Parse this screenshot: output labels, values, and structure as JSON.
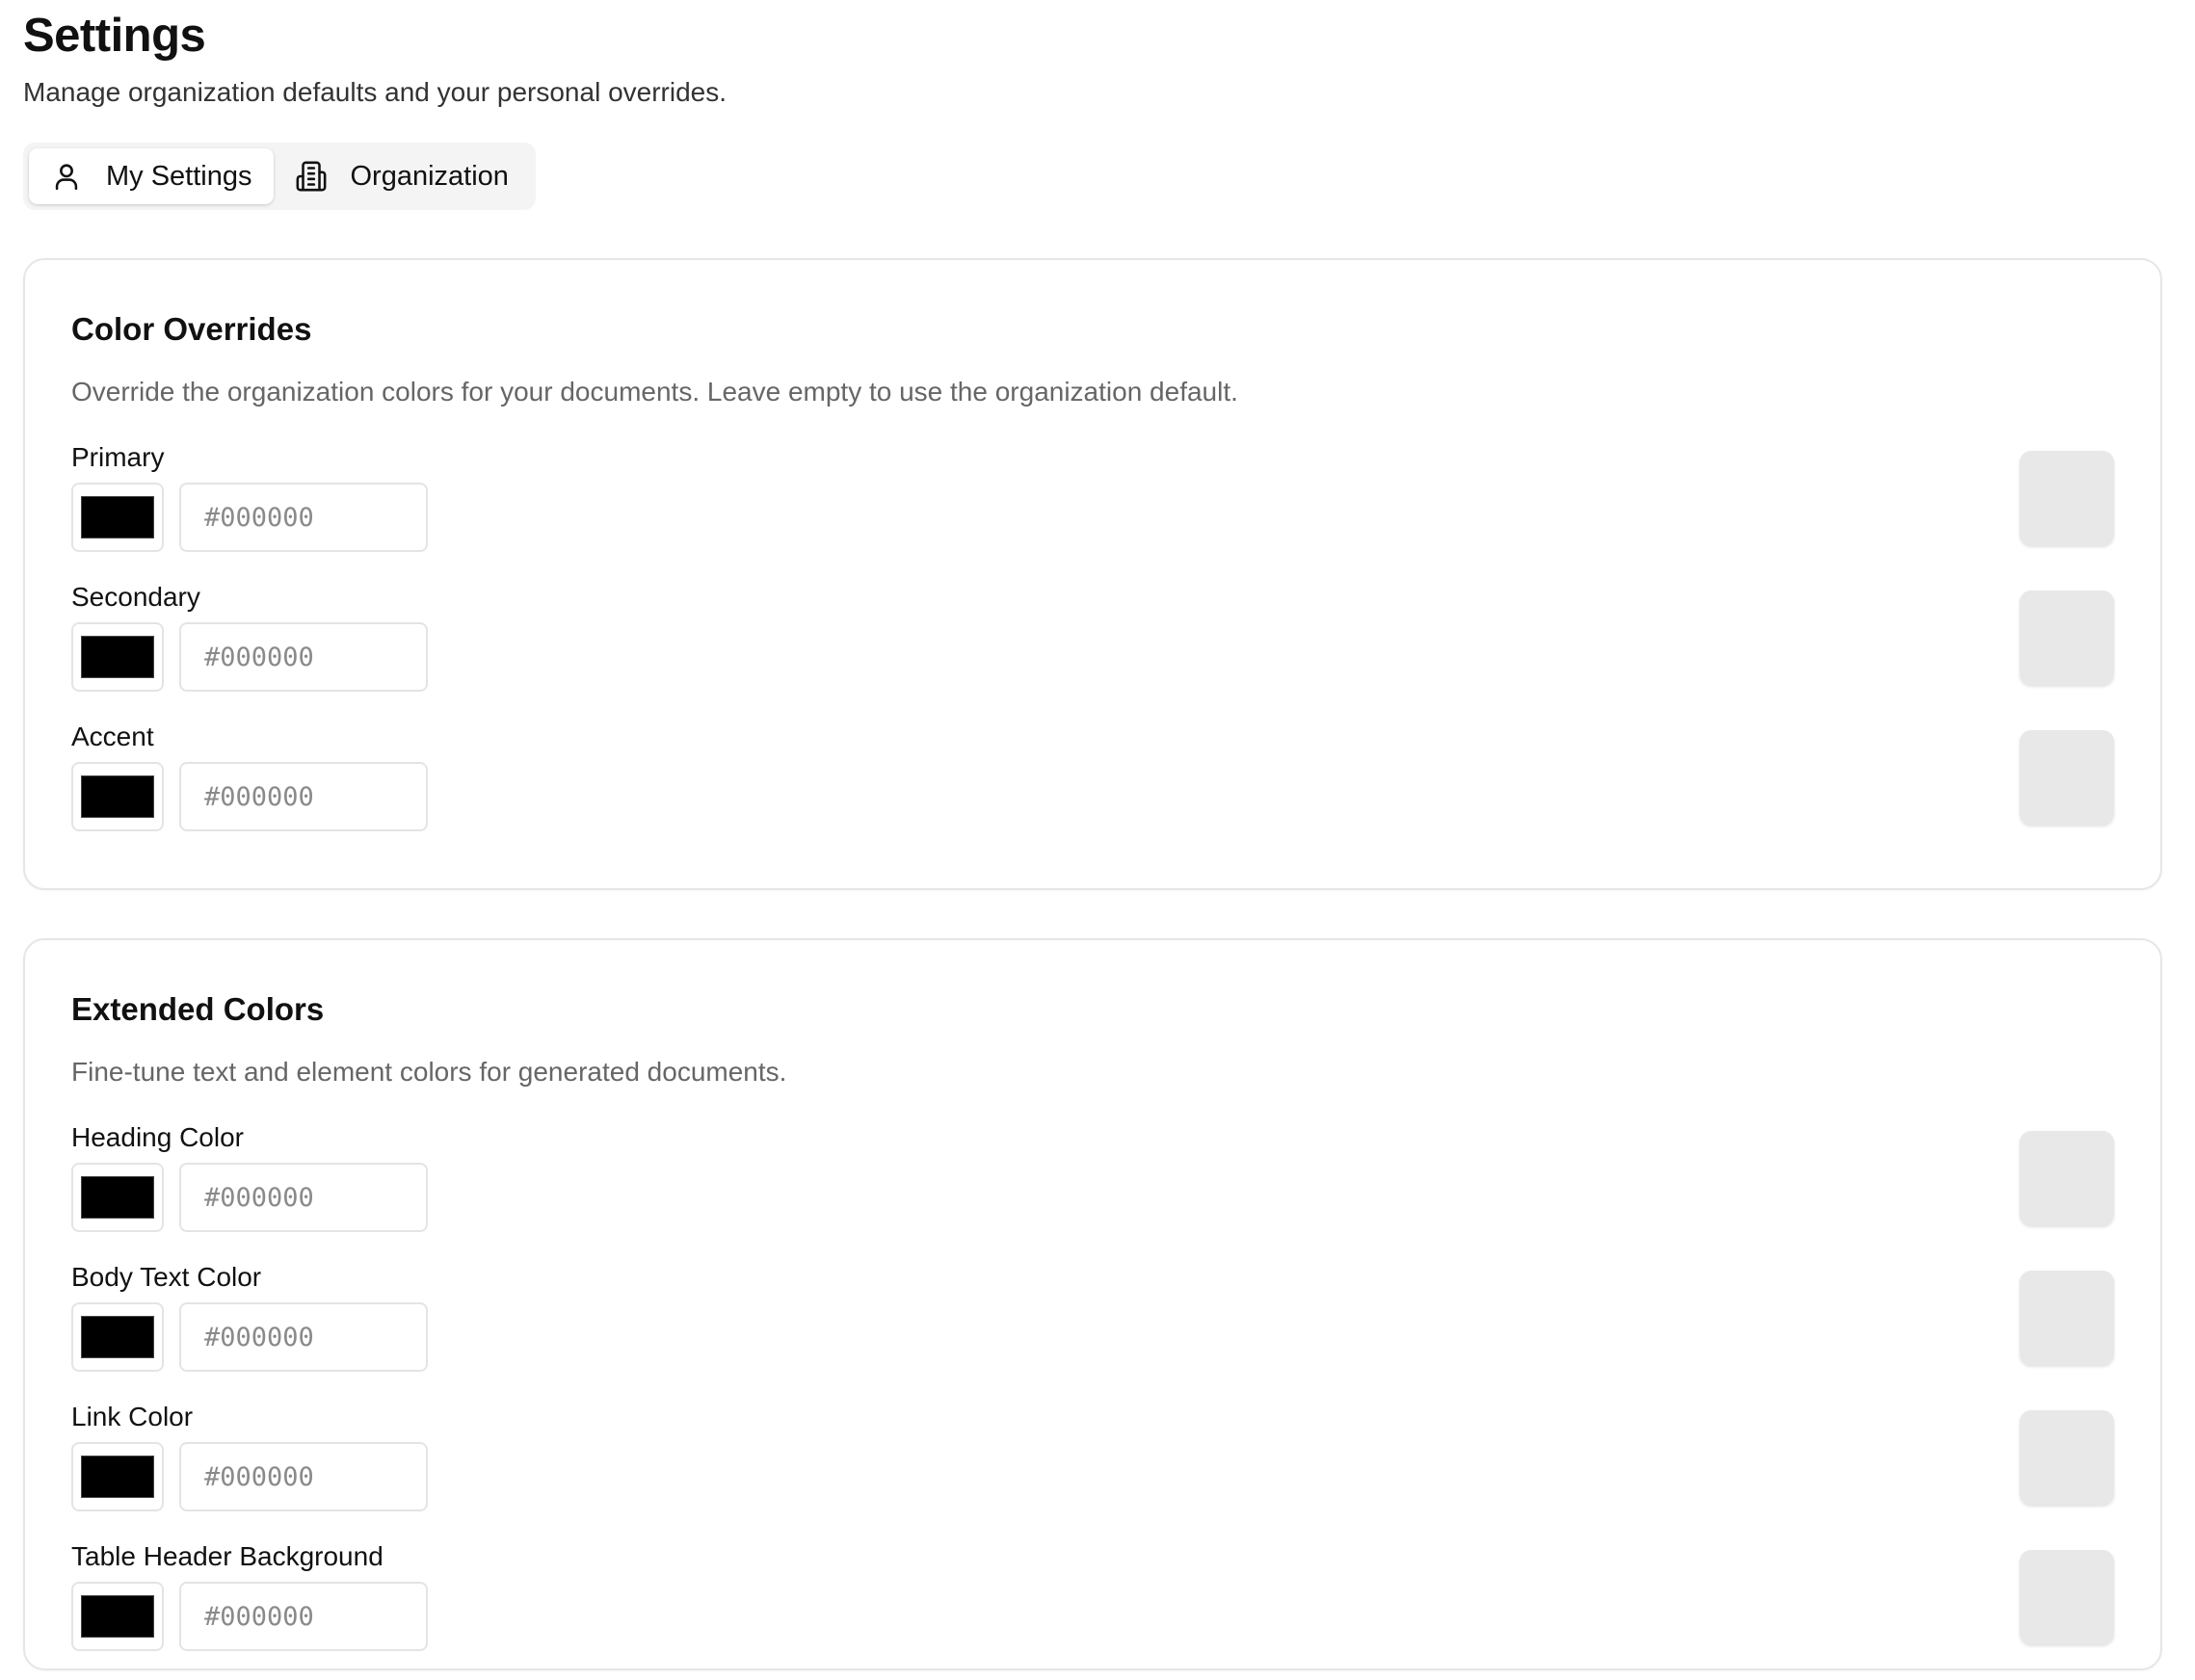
{
  "header": {
    "title": "Settings",
    "subtitle": "Manage organization defaults and your personal overrides."
  },
  "tabs": [
    {
      "label": "My Settings",
      "icon": "user-icon",
      "active": true
    },
    {
      "label": "Organization",
      "icon": "building-icon",
      "active": false
    }
  ],
  "color_overrides": {
    "title": "Color Overrides",
    "description": "Override the organization colors for your documents. Leave empty to use the organization default.",
    "fields": [
      {
        "label": "Primary",
        "value": "",
        "placeholder": "#000000",
        "swatch": "#000000"
      },
      {
        "label": "Secondary",
        "value": "",
        "placeholder": "#000000",
        "swatch": "#000000"
      },
      {
        "label": "Accent",
        "value": "",
        "placeholder": "#000000",
        "swatch": "#000000"
      }
    ]
  },
  "extended_colors": {
    "title": "Extended Colors",
    "description": "Fine-tune text and element colors for generated documents.",
    "fields": [
      {
        "label": "Heading Color",
        "value": "",
        "placeholder": "#000000",
        "swatch": "#000000"
      },
      {
        "label": "Body Text Color",
        "value": "",
        "placeholder": "#000000",
        "swatch": "#000000"
      },
      {
        "label": "Link Color",
        "value": "",
        "placeholder": "#000000",
        "swatch": "#000000"
      },
      {
        "label": "Table Header Background",
        "value": "",
        "placeholder": "#000000",
        "swatch": "#000000"
      }
    ]
  },
  "colors": {
    "swatch_default": "#000000",
    "reset_button_bg": "#e8e8e8",
    "card_border": "#e6e6e6",
    "muted_text": "#666666"
  }
}
